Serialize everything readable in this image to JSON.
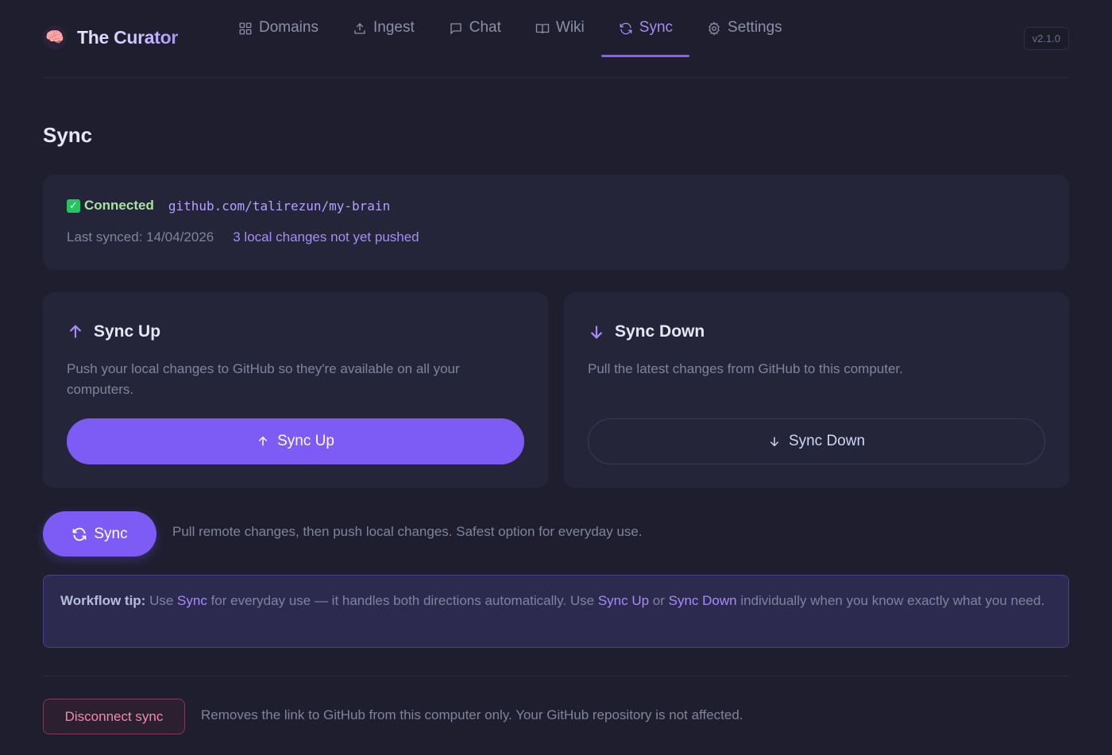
{
  "app": {
    "name": "The Curator",
    "version": "v2.1.0",
    "logo_icon": "brain-icon"
  },
  "nav": {
    "items": [
      {
        "label": "Domains",
        "icon": "grid-icon",
        "active": false
      },
      {
        "label": "Ingest",
        "icon": "upload-icon",
        "active": false
      },
      {
        "label": "Chat",
        "icon": "chat-bubble-icon",
        "active": false
      },
      {
        "label": "Wiki",
        "icon": "book-icon",
        "active": false
      },
      {
        "label": "Sync",
        "icon": "refresh-icon",
        "active": true
      },
      {
        "label": "Settings",
        "icon": "gear-icon",
        "active": false
      }
    ]
  },
  "page": {
    "title": "Sync"
  },
  "status": {
    "connected_label": "Connected",
    "repo": "github.com/talirezun/my-brain",
    "last_synced": "Last synced: 14/04/2026",
    "pending": "3 local changes not yet pushed"
  },
  "sync_up": {
    "title": "Sync Up",
    "description": "Push your local changes to GitHub so they're available on all your computers.",
    "button": "Sync Up"
  },
  "sync_down": {
    "title": "Sync Down",
    "description": "Pull the latest changes from GitHub to this computer.",
    "button": "Sync Down"
  },
  "sync": {
    "button": "Sync",
    "description": "Pull remote changes, then push local changes. Safest option for everyday use."
  },
  "tip": {
    "label": "Workflow tip:",
    "t1": " Use ",
    "k1": "Sync",
    "t2": " for everyday use — it handles both directions automatically. Use ",
    "k2": "Sync Up",
    "t3": " or ",
    "k3": "Sync Down",
    "t4": " individually when you know exactly what you need."
  },
  "disconnect": {
    "button": "Disconnect sync",
    "description": "Removes the link to GitHub from this computer only. Your GitHub repository is not affected."
  },
  "colors": {
    "accent": "#7c5cf5",
    "success": "#a6e3a1",
    "danger": "#f38ba8",
    "background": "#1e1e2e"
  }
}
